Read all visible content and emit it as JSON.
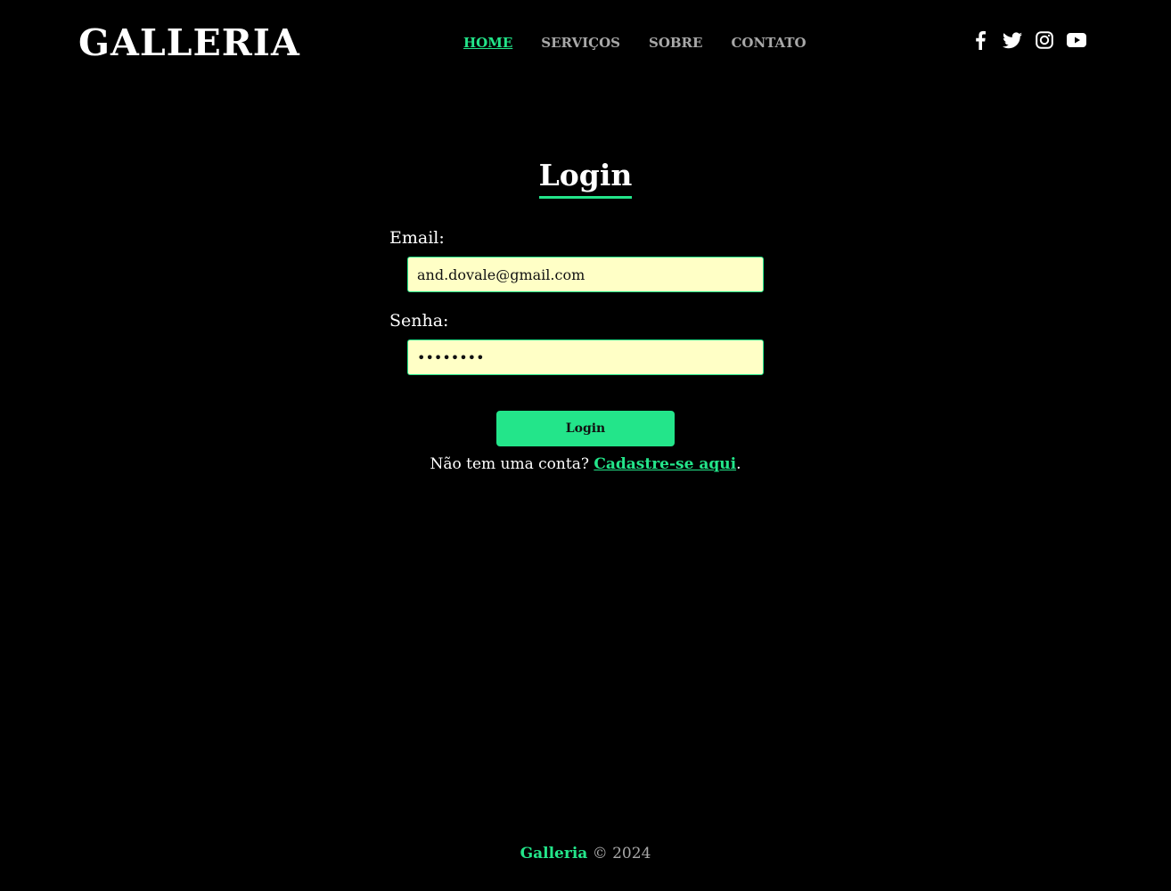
{
  "header": {
    "brand": "GALLERIA",
    "nav": [
      {
        "label": "HOME",
        "active": true
      },
      {
        "label": "SERVIÇOS",
        "active": false
      },
      {
        "label": "SOBRE",
        "active": false
      },
      {
        "label": "CONTATO",
        "active": false
      }
    ],
    "social": [
      "facebook-icon",
      "twitter-icon",
      "instagram-icon",
      "youtube-icon"
    ]
  },
  "login": {
    "title": "Login",
    "email_label": "Email:",
    "email_value": "and.dovale@gmail.com",
    "password_label": "Senha:",
    "password_value": "12345678",
    "button_label": "Login",
    "signup_prefix": "Não tem uma conta? ",
    "signup_link": "Cadastre-se aqui",
    "signup_suffix": "."
  },
  "footer": {
    "brand": "Galleria",
    "copyright": " © 2024"
  },
  "colors": {
    "accent": "#23e58a",
    "background": "#000000",
    "input_bg": "#ffffc6",
    "nav_inactive": "#a8a8a8"
  }
}
